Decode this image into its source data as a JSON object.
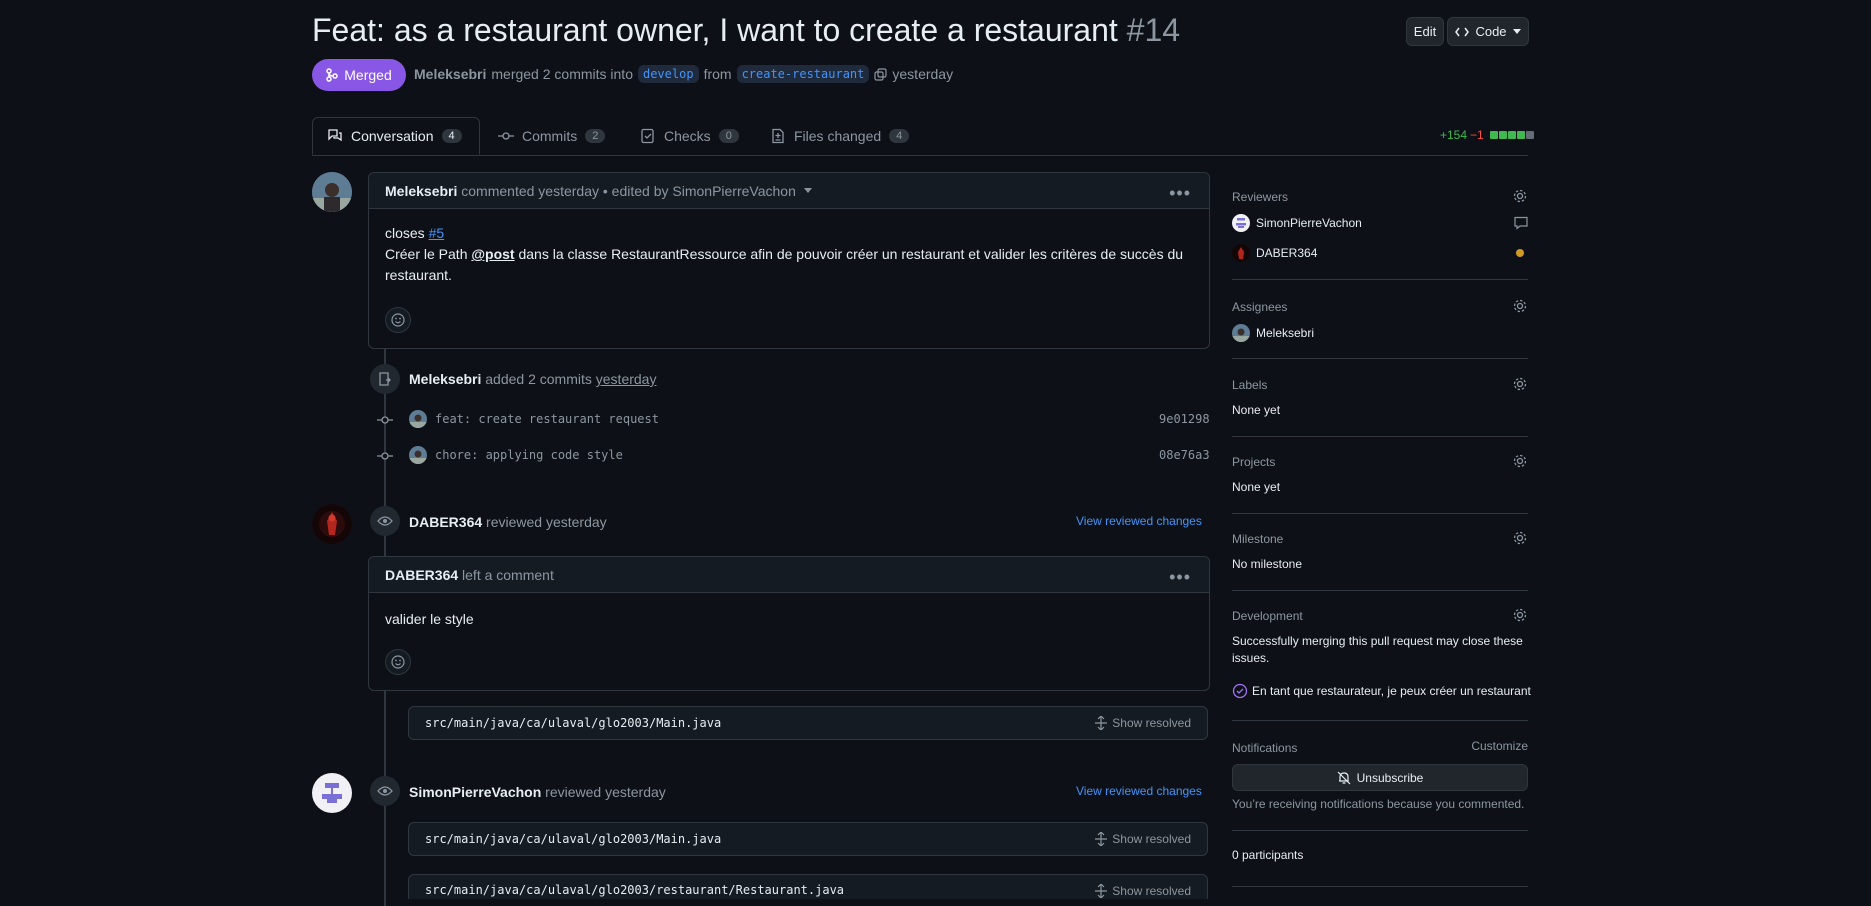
{
  "pr": {
    "title": "Feat: as a restaurant owner, I want to create a restaurant",
    "number": "#14",
    "edit_label": "Edit",
    "code_label": "Code",
    "state": "Merged",
    "author": "Meleksebri",
    "merge_text": "merged 2 commits into",
    "base_branch": "develop",
    "from_text": "from",
    "head_branch": "create-restaurant",
    "time": "yesterday"
  },
  "tabs": [
    {
      "label": "Conversation",
      "count": "4"
    },
    {
      "label": "Commits",
      "count": "2"
    },
    {
      "label": "Checks",
      "count": "0"
    },
    {
      "label": "Files changed",
      "count": "4"
    }
  ],
  "diffstat": {
    "additions": "+154",
    "deletions": "−1"
  },
  "comment1": {
    "author": "Meleksebri",
    "meta": "commented yesterday • edited by SimonPierreVachon",
    "closes": "closes",
    "issue_ref": "#5",
    "body_pre": "Créer le Path",
    "mention": "@post",
    "body_post": "dans la classe RestaurantRessource afin de pouvoir créer un restaurant et valider les critères de succès du",
    "body_line2": "restaurant."
  },
  "commits_event": {
    "author": "Meleksebri",
    "text": "added 2 commits",
    "time": "yesterday",
    "commits": [
      {
        "message": "feat: create restaurant request",
        "sha": "9e01298"
      },
      {
        "message": "chore: applying code style",
        "sha": "08e76a3"
      }
    ]
  },
  "review1": {
    "author": "DABER364",
    "text": "reviewed yesterday",
    "link": "View reviewed changes",
    "comment_author": "DABER364",
    "comment_meta": "left a comment",
    "comment_body": "valider le style",
    "file": "src/main/java/ca/ulaval/glo2003/Main.java",
    "show_resolved": "Show resolved"
  },
  "review2": {
    "author": "SimonPierreVachon",
    "text": "reviewed yesterday",
    "link": "View reviewed changes",
    "files": [
      "src/main/java/ca/ulaval/glo2003/Main.java",
      "src/main/java/ca/ulaval/glo2003/restaurant/Restaurant.java"
    ],
    "show_resolved": "Show resolved"
  },
  "sidebar": {
    "reviewers_label": "Reviewers",
    "reviewers": [
      "SimonPierreVachon",
      "DABER364"
    ],
    "assignees_label": "Assignees",
    "assignee": "Meleksebri",
    "labels_label": "Labels",
    "labels_value": "None yet",
    "projects_label": "Projects",
    "projects_value": "None yet",
    "milestone_label": "Milestone",
    "milestone_value": "No milestone",
    "development_label": "Development",
    "development_text": "Successfully merging this pull request may close these issues.",
    "linked_issue": "En tant que restaurateur, je peux créer un restaurant",
    "notifications_label": "Notifications",
    "customize": "Customize",
    "unsubscribe": "Unsubscribe",
    "notif_reason": "You’re receiving notifications because you commented.",
    "participants": "0 participants"
  },
  "colors": {
    "background": "#0d1117",
    "merged": "#8957e5",
    "link": "#4493f8",
    "additions": "#3fb950",
    "deletions": "#f85149",
    "pending_review": "#d29922"
  }
}
